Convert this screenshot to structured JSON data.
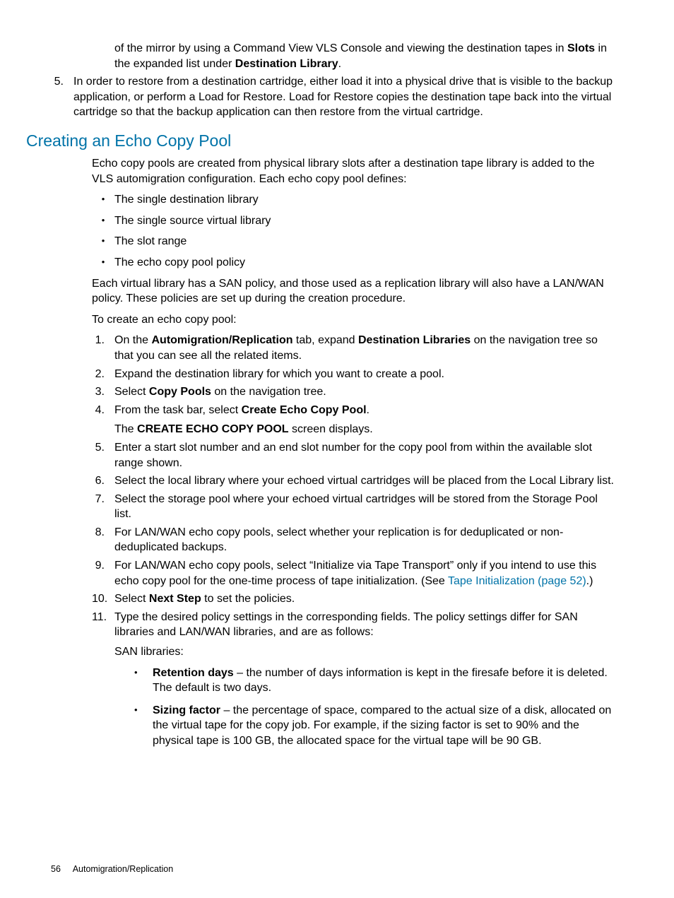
{
  "top": {
    "continued_text_pre": "of the mirror by using a Command View VLS Console and viewing the destination tapes in ",
    "continued_bold1": "Slots",
    "continued_text_mid": " in the expanded list under ",
    "continued_bold2": "Destination Library",
    "continued_text_end": ".",
    "step5_num": "5.",
    "step5_text": "In order to restore from a destination cartridge, either load it into a physical drive that is visible to the backup application, or perform a Load for Restore. Load for Restore copies the destination tape back into the virtual cartridge so that the backup application can then restore from the virtual cartridge."
  },
  "section_heading": "Creating an Echo Copy Pool",
  "intro_p1": "Echo copy pools are created from physical library slots after a destination tape library is added to the VLS automigration configuration. Each echo copy pool defines:",
  "defines": [
    "The single destination library",
    "The single source virtual library",
    "The slot range",
    "The echo copy pool policy"
  ],
  "intro_p2": "Each virtual library has a SAN policy, and those used as a replication library will also have a LAN/WAN policy. These policies are set up during the creation procedure.",
  "intro_p3": "To create an echo copy pool:",
  "steps": {
    "s1_num": "1.",
    "s1_pre": "On the ",
    "s1_b1": "Automigration/Replication",
    "s1_mid": " tab, expand ",
    "s1_b2": "Destination Libraries",
    "s1_end": " on the navigation tree so that you can see all the related items.",
    "s2_num": "2.",
    "s2_text": "Expand the destination library for which you want to create a pool.",
    "s3_num": "3.",
    "s3_pre": "Select ",
    "s3_b1": "Copy Pools",
    "s3_end": " on the navigation tree.",
    "s4_num": "4.",
    "s4_pre": "From the task bar, select ",
    "s4_b1": "Create Echo Copy Pool",
    "s4_end": ".",
    "s4_extra_pre": "The ",
    "s4_extra_b": "CREATE ECHO COPY POOL",
    "s4_extra_end": " screen displays.",
    "s5_num": "5.",
    "s5_text": "Enter a start slot number and an end slot number for the copy pool from within the available slot range shown.",
    "s6_num": "6.",
    "s6_text": "Select the local library where your echoed virtual cartridges will be placed from the Local Library list.",
    "s7_num": "7.",
    "s7_text": "Select the storage pool where your echoed virtual cartridges will be stored from the Storage Pool list.",
    "s8_num": "8.",
    "s8_text": "For LAN/WAN echo copy pools, select whether your replication is for deduplicated or non-deduplicated backups.",
    "s9_num": "9.",
    "s9_pre": "For LAN/WAN echo copy pools, select “Initialize via Tape Transport” only if you intend to use this echo copy pool for the one-time process of tape initialization. (See ",
    "s9_link": "Tape Initialization (page 52)",
    "s9_end": ".)",
    "s10_num": "10.",
    "s10_pre": "Select ",
    "s10_b1": "Next Step",
    "s10_end": " to set the policies.",
    "s11_num": "11.",
    "s11_text": "Type the desired policy settings in the corresponding fields. The policy settings differ for SAN libraries and LAN/WAN libraries, and are as follows:",
    "s11_san_label": "SAN libraries:",
    "s11_ret_b": "Retention days",
    "s11_ret_text": " – the number of days information is kept in the firesafe before it is deleted. The default is two days.",
    "s11_siz_b": "Sizing factor",
    "s11_siz_text": " – the percentage of space, compared to the actual size of a disk, allocated on the virtual tape for the copy job. For example, if the sizing factor is set to 90% and the physical tape is 100 GB, the allocated space for the virtual tape will be 90 GB."
  },
  "footer": {
    "page_num": "56",
    "section": "Automigration/Replication"
  }
}
